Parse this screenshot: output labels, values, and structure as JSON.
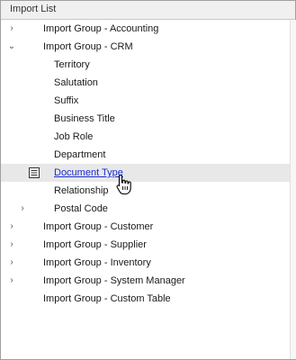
{
  "panel": {
    "title": "Import List"
  },
  "tree": {
    "groups": [
      {
        "label": "Import Group - Accounting",
        "expanded": false,
        "has_children": true
      },
      {
        "label": "Import Group - CRM",
        "expanded": true,
        "has_children": true,
        "children": [
          {
            "label": "Territory"
          },
          {
            "label": "Salutation"
          },
          {
            "label": "Suffix"
          },
          {
            "label": "Business Title"
          },
          {
            "label": "Job Role"
          },
          {
            "label": "Department"
          },
          {
            "label": "Document Type",
            "selected": true,
            "hovered": true,
            "icon": "document-list-icon"
          },
          {
            "label": "Relationship"
          },
          {
            "label": "Postal Code",
            "has_children": true,
            "expanded": false
          }
        ]
      },
      {
        "label": "Import Group - Customer",
        "expanded": false,
        "has_children": true
      },
      {
        "label": "Import Group - Supplier",
        "expanded": false,
        "has_children": true
      },
      {
        "label": "Import Group - Inventory",
        "expanded": false,
        "has_children": true
      },
      {
        "label": "Import Group - System Manager",
        "expanded": false,
        "has_children": true
      },
      {
        "label": "Import Group - Custom Table",
        "expanded": false,
        "has_children": false
      }
    ]
  },
  "icons": {
    "collapsed": "chevron-right-icon",
    "expanded": "chevron-down-icon",
    "cursor": "hand-pointer-cursor-icon"
  },
  "colors": {
    "link": "#1a2dd0",
    "selected_row": "#e8e8e8",
    "header_bg": "#f0f0f0",
    "border": "#a0a0a0"
  }
}
